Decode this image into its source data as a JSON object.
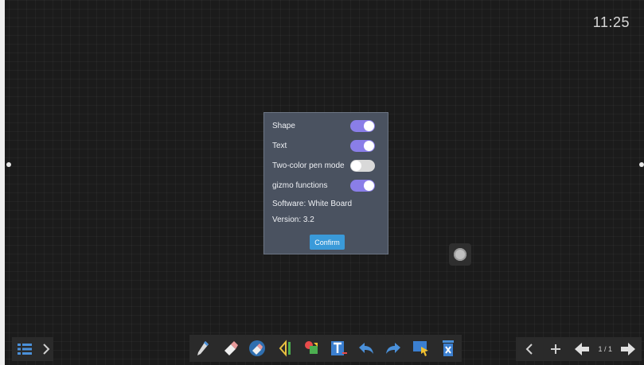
{
  "status": {
    "time": "11:25"
  },
  "dialog": {
    "toggles": [
      {
        "label": "Shape",
        "on": true
      },
      {
        "label": "Text",
        "on": true
      },
      {
        "label": "Two-color pen mode",
        "on": false
      },
      {
        "label": "gizmo functions",
        "on": true
      }
    ],
    "software": "Software: White Board",
    "version": "Version: 3.2",
    "confirm_label": "Confirm"
  },
  "toolbar": {
    "tools": [
      "pen-icon",
      "eraser-icon",
      "clear-eraser-icon",
      "ruler-icon",
      "shape-icon",
      "text-icon",
      "undo-icon",
      "redo-icon",
      "select-icon",
      "delete-icon"
    ]
  },
  "nav": {
    "page": "1 / 1"
  },
  "colors": {
    "accent": "#8a7ee8",
    "confirm": "#3a9ad9",
    "tool_blue": "#4a90d9"
  }
}
